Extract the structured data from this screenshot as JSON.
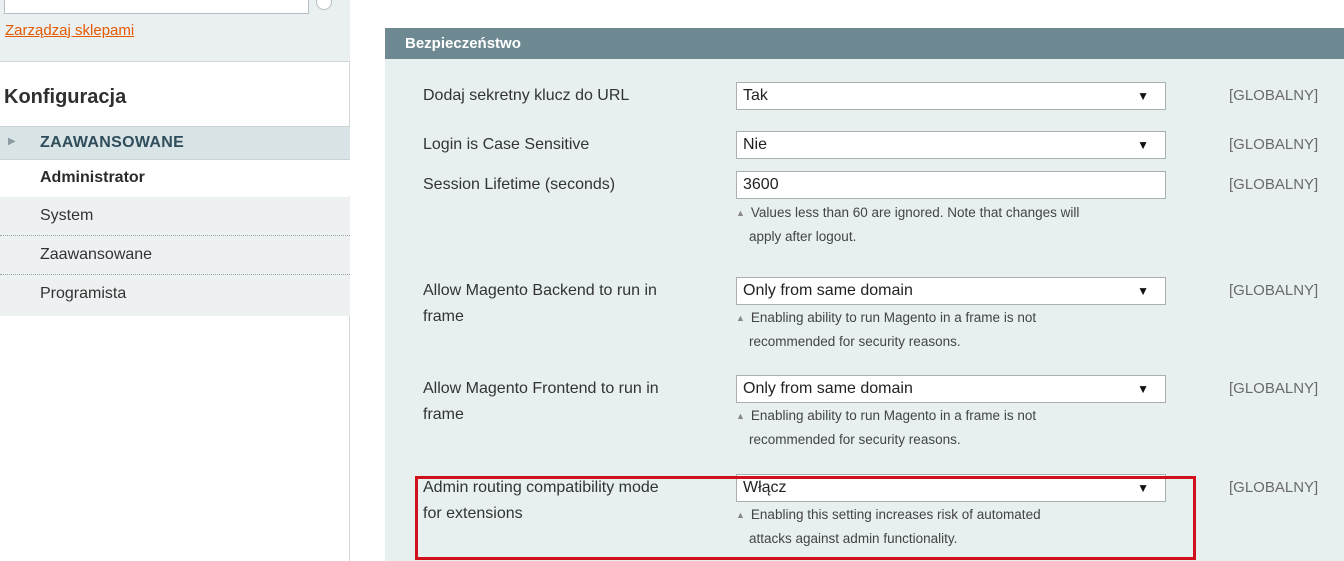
{
  "sidebar": {
    "manage_stores": "Zarządzaj sklepami",
    "config_title": "Konfiguracja",
    "section": "ZAAWANSOWANE",
    "active_item": "Administrator",
    "items": [
      "System",
      "Zaawansowane",
      "Programista"
    ]
  },
  "panel": {
    "title": "Bezpieczeństwo",
    "rows": [
      {
        "label": "Dodaj sekretny klucz do URL",
        "value": "Tak",
        "scope": "[GLOBALNY]"
      },
      {
        "label": "Login is Case Sensitive",
        "value": "Nie",
        "scope": "[GLOBALNY]"
      },
      {
        "label": "Session Lifetime (seconds)",
        "value": "3600",
        "scope": "[GLOBALNY]",
        "note1": "Values less than 60 are ignored. Note that changes will",
        "note2": "apply after logout."
      },
      {
        "label1": "Allow Magento Backend to run in",
        "label2": "frame",
        "value": "Only from same domain",
        "scope": "[GLOBALNY]",
        "note1": "Enabling ability to run Magento in a frame is not",
        "note2": "recommended for security reasons."
      },
      {
        "label1": "Allow Magento Frontend to run in",
        "label2": "frame",
        "value": "Only from same domain",
        "scope": "[GLOBALNY]",
        "note1": "Enabling ability to run Magento in a frame is not",
        "note2": "recommended for security reasons."
      },
      {
        "label1": "Admin routing compatibility mode",
        "label2": "for extensions",
        "value": "Włącz",
        "scope": "[GLOBALNY]",
        "note1": "Enabling this setting increases risk of automated",
        "note2": "attacks against admin functionality."
      }
    ]
  },
  "icons": {
    "dropdown": "dropdown-arrow-icon",
    "note": "note-triangle-icon",
    "section_toggle": "section-arrow-icon"
  },
  "colors": {
    "header_bg": "#6f8992",
    "panel_bg": "#e7efef",
    "link": "#e35a00",
    "highlight": "#d0101a"
  }
}
